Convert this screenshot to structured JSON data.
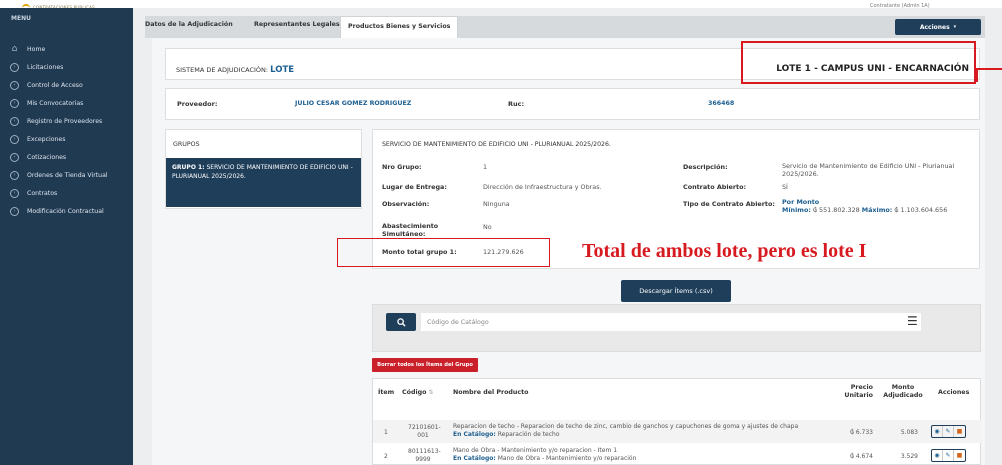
{
  "header": {
    "logo_text": "CONTRATACIONES PÚBLICAS",
    "user_text": "Contratante (Admin 1A)"
  },
  "sidebar": {
    "menu_title": "MENU",
    "items": [
      {
        "label": "Home",
        "icon": "home-icon"
      },
      {
        "label": "Licitaciones",
        "icon": "chevron-right-icon"
      },
      {
        "label": "Control de Acceso",
        "icon": "chevron-right-icon"
      },
      {
        "label": "Mis Convocatorias",
        "icon": "chevron-right-icon"
      },
      {
        "label": "Registro de Proveedores",
        "icon": "chevron-right-icon"
      },
      {
        "label": "Excepciones",
        "icon": "chevron-right-icon"
      },
      {
        "label": "Cotizaciones",
        "icon": "chevron-right-icon"
      },
      {
        "label": "Ordenes de Tienda Virtual",
        "icon": "chevron-right-icon"
      },
      {
        "label": "Contratos",
        "icon": "chevron-right-icon"
      },
      {
        "label": "Modificación Contractual",
        "icon": "chevron-right-icon"
      }
    ]
  },
  "tabs": [
    {
      "label": "Datos de la Adjudicación"
    },
    {
      "label": "Representantes Legales"
    },
    {
      "label": "Productos Bienes y Servicios"
    }
  ],
  "actions_button": "Acciones",
  "title_bar": {
    "sistema_label": "SISTEMA DE ADJUDICACIÓN: ",
    "sistema_value": "LOTE",
    "lote_name": "LOTE 1 - CAMPUS UNI - ENCARNACIÓN"
  },
  "provider": {
    "label": "Proveedor:",
    "name": "JULIO CESAR GOMEZ RODRIGUEZ",
    "ruc_label": "Ruc:",
    "ruc": "366468"
  },
  "grupos": {
    "title": "GRUPOS",
    "selected_prefix": "GRUPO 1:",
    "selected_text": " SERVICIO DE MANTENIMIENTO DE EDIFICIO UNI - PLURIANUAL 2025/2026."
  },
  "detail": {
    "title": "SERVICIO DE MANTENIMIENTO DE EDIFICIO UNI - PLURIANUAL 2025/2026.",
    "nro_grupo_label": "Nro Grupo:",
    "nro_grupo": "1",
    "lugar_label": "Lugar de Entrega:",
    "lugar": "Dirección de Infraestructura y Obras.",
    "observacion_label": "Observación:",
    "observacion": "Ninguna",
    "abastecimiento_label": "Abastecimiento Simultáneo:",
    "abastecimiento": "No",
    "monto_label": "Monto total grupo 1:",
    "monto": "121.279.626",
    "descripcion_label": "Descripción:",
    "descripcion": "Servicio de Mantenimiento de Edificio UNI - Plurianual 2025/2026.",
    "contrato_abierto_label": "Contrato Abierto:",
    "contrato_abierto": "SÍ",
    "tipo_contrato_label": "Tipo de Contrato Abierto:",
    "tipo_contrato": "Por Monto",
    "minimo_label": "Mínimo:",
    "minimo": "₲ 551.802.328",
    "maximo_label": "Máximo:",
    "maximo": "₲ 1.103.604.656"
  },
  "annotation": "Total de ambos lote, pero es lote I",
  "download_button": "Descargar Ítems (.csv)",
  "search": {
    "placeholder": "Código de Catálogo"
  },
  "delete_all_button": "Borrar todos los Ítems del Grupo",
  "table": {
    "headers": {
      "item": "Ítem",
      "codigo": "Código",
      "nombre": "Nombre del Producto",
      "precio_1": "Precio",
      "precio_2": "Unitario",
      "monto_1": "Monto",
      "monto_2": "Adjudicado",
      "acciones": "Acciones"
    },
    "rows": [
      {
        "item": "1",
        "codigo_1": "72101601-",
        "codigo_2": "001",
        "nombre": "Reparacion de techo - Reparacion de techo de zinc, cambio de ganchos y capuchones de goma y ajustes de chapa",
        "cat_label": "En Catálogo:",
        "cat_value": " Reparación de techo",
        "precio": "₲ 6.733",
        "monto": "5.083"
      },
      {
        "item": "2",
        "codigo_1": "80111613-",
        "codigo_2": "9999",
        "nombre": "Mano de Obra - Mantenimiento y/o reparacion - Item 1",
        "cat_label": "En Catálogo:",
        "cat_value": " Mano de Obra - Mantenimiento y/o reparación",
        "precio": "₲ 4.674",
        "monto": "3.529"
      }
    ]
  }
}
